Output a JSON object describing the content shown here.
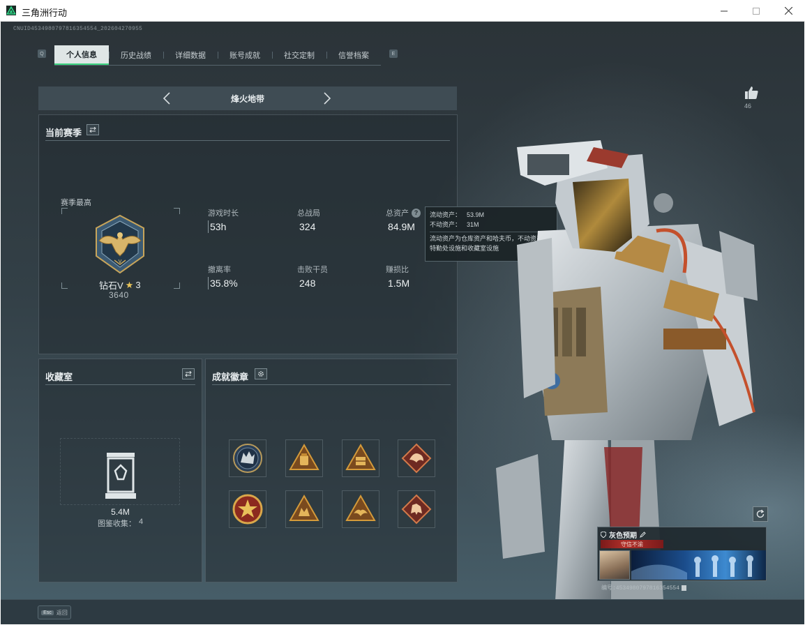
{
  "window": {
    "title": "三角洲行动",
    "accent": "#1aa86b"
  },
  "header": {
    "uid_text": "CNUID4534980797816354554_202604270955",
    "tabs": [
      {
        "label": "个人信息",
        "active": true
      },
      {
        "label": "历史战绩",
        "active": false
      },
      {
        "label": "详细数据",
        "active": false
      },
      {
        "label": "账号成就",
        "active": false
      },
      {
        "label": "社交定制",
        "active": false
      },
      {
        "label": "信誉档案",
        "active": false
      }
    ],
    "tab_key_left": "Q",
    "tab_key_right": "E"
  },
  "mode": {
    "title": "烽火地带"
  },
  "season": {
    "title": "当前赛季",
    "best_label": "赛季最高",
    "rank_name": "钻石V",
    "rank_stars": "3",
    "rank_score": "3640",
    "stats": [
      {
        "label": "游戏时长",
        "value": "53h"
      },
      {
        "label": "总战局",
        "value": "324"
      },
      {
        "label": "总资产",
        "value": "84.9M",
        "has_help": true
      },
      {
        "label": "撤离率",
        "value": "35.8%"
      },
      {
        "label": "击败干员",
        "value": "248"
      },
      {
        "label": "赚损比",
        "value": "1.5M"
      }
    ]
  },
  "tooltip": {
    "liquid_label": "流动资产：",
    "liquid_value": "53.9M",
    "fixed_label": "不动资产：",
    "fixed_value": "31M",
    "description": "流动资产为仓库资产和哈夫币，不动资产为特勤处设施和收藏室设施"
  },
  "collection": {
    "title": "收藏室",
    "value": "5.4M",
    "count_label": "图鉴收集：",
    "count_value": "4"
  },
  "badges": {
    "title": "成就徽章",
    "items": [
      {
        "icon": "wolf-emblem-icon"
      },
      {
        "icon": "backpack-triangle-icon"
      },
      {
        "icon": "crate-triangle-icon"
      },
      {
        "icon": "dragon-diamond-icon"
      },
      {
        "icon": "star-medal-icon"
      },
      {
        "icon": "beast-triangle-icon"
      },
      {
        "icon": "eagle-triangle-icon"
      },
      {
        "icon": "dog-diamond-icon"
      }
    ]
  },
  "profile": {
    "like_count": "46",
    "card_name": "灰色预期",
    "card_tag": "守信不渝",
    "card_uid": "编号:4534980797816354554"
  },
  "footer": {
    "esc_key": "Esc",
    "esc_label": "返回"
  }
}
